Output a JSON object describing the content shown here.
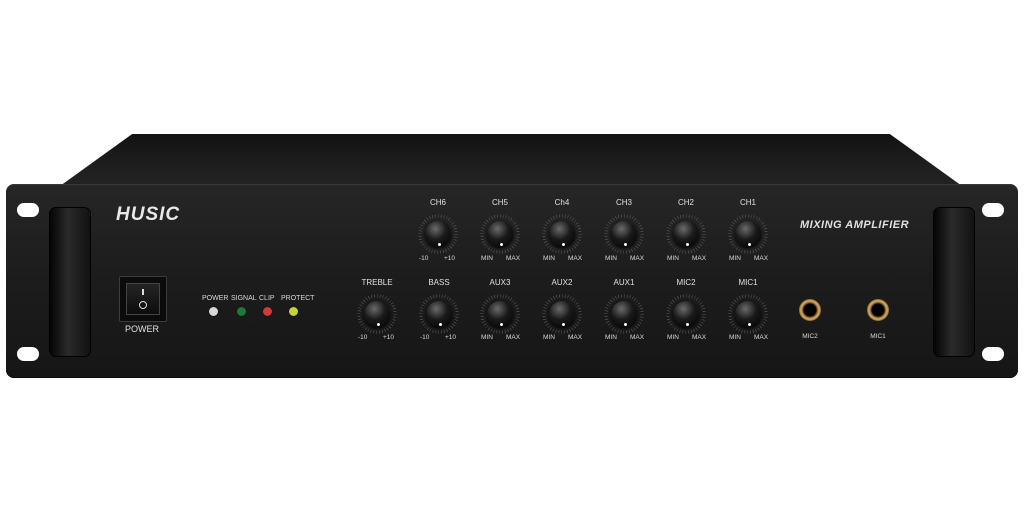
{
  "device": {
    "brand": "HUSIC",
    "model_title": "MIXING AMPLIFIER",
    "power_switch_label": "POWER",
    "leds": [
      {
        "label": "POWER",
        "color": "#d8d8d8"
      },
      {
        "label": "SIGNAL",
        "color": "#1f7a3a"
      },
      {
        "label": "CLIP",
        "color": "#d23a3a"
      },
      {
        "label": "PROTECT",
        "color": "#c8d23a"
      }
    ],
    "top_knobs": [
      {
        "label": "CH6",
        "min": "-10",
        "max": "+10"
      },
      {
        "label": "CH5",
        "min": "MIN",
        "max": "MAX"
      },
      {
        "label": "Ch4",
        "min": "MIN",
        "max": "MAX"
      },
      {
        "label": "CH3",
        "min": "MIN",
        "max": "MAX"
      },
      {
        "label": "CH2",
        "min": "MIN",
        "max": "MAX"
      },
      {
        "label": "CH1",
        "min": "MIN",
        "max": "MAX"
      }
    ],
    "bottom_knobs": [
      {
        "label": "TREBLE",
        "min": "-10",
        "max": "+10"
      },
      {
        "label": "BASS",
        "min": "-10",
        "max": "+10"
      },
      {
        "label": "AUX3",
        "min": "MIN",
        "max": "MAX"
      },
      {
        "label": "AUX2",
        "min": "MIN",
        "max": "MAX"
      },
      {
        "label": "AUX1",
        "min": "MIN",
        "max": "MAX"
      },
      {
        "label": "MIC2",
        "min": "MIN",
        "max": "MAX"
      },
      {
        "label": "MIC1",
        "min": "MIN",
        "max": "MAX"
      }
    ],
    "jacks": [
      {
        "label": "MIC2"
      },
      {
        "label": "MIC1"
      }
    ]
  }
}
